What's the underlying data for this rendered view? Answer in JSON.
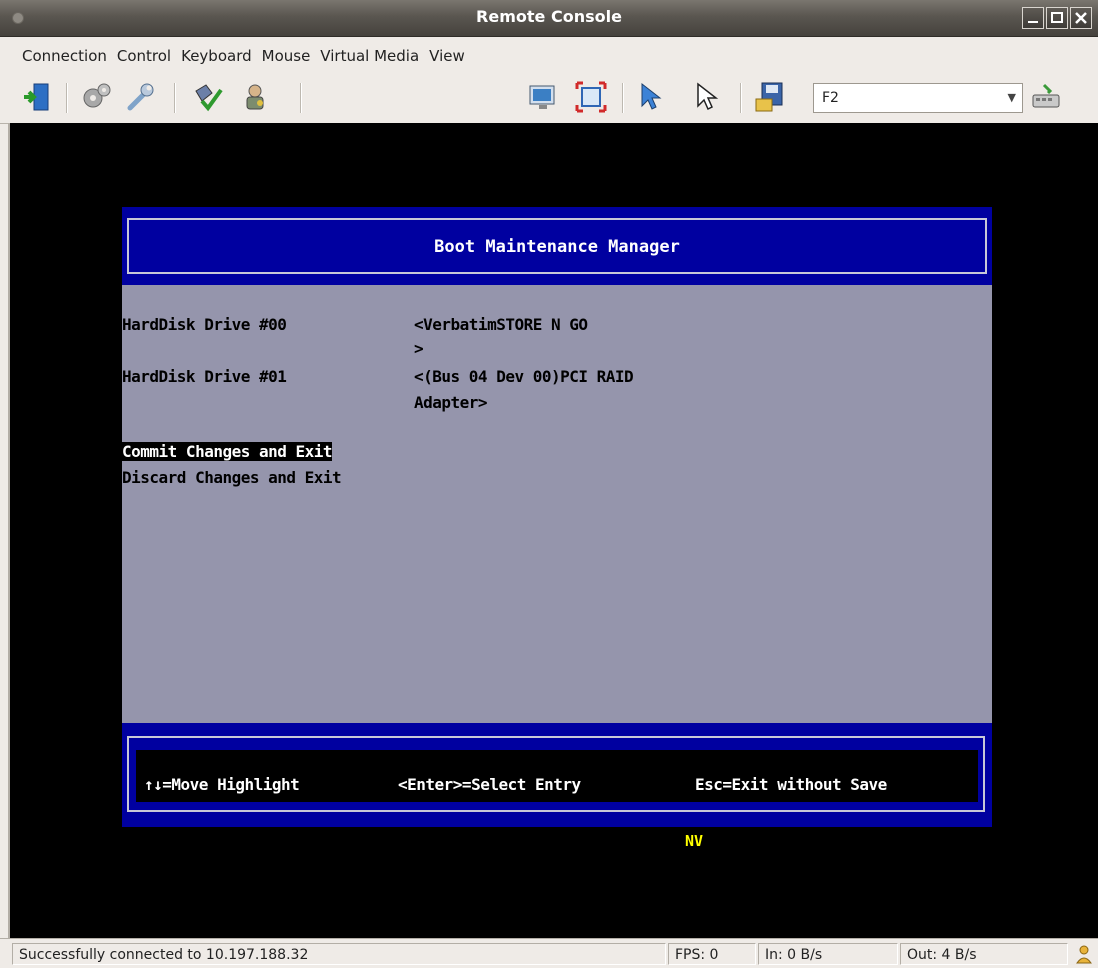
{
  "window": {
    "title": "Remote Console"
  },
  "menu": [
    "Connection",
    "Control",
    "Keyboard",
    "Mouse",
    "Virtual Media",
    "View"
  ],
  "toolbar": {
    "key_combo_value": "F2"
  },
  "bios": {
    "title": "Boot Maintenance Manager",
    "rows": [
      {
        "label": "HardDisk Drive #00",
        "value_line1": "<VerbatimSTORE N GO",
        "value_line2": ">"
      },
      {
        "label": "HardDisk Drive #01",
        "value_line1": "<(Bus 04 Dev 00)PCI RAID",
        "value_line2": "Adapter>"
      }
    ],
    "actions": [
      "Commit Changes and Exit",
      "Discard Changes and Exit"
    ],
    "footer": {
      "move": "↑↓=Move Highlight",
      "select": "<Enter>=Select Entry",
      "exit": "Esc=Exit without Save"
    },
    "indicator": "NV"
  },
  "status": {
    "message": "Successfully connected to 10.197.188.32",
    "fps": "FPS: 0",
    "in": "In: 0 B/s",
    "out": "Out: 4 B/s"
  },
  "colors": {
    "bios_blue": "#0000a0",
    "bios_gray": "#9595ac",
    "nv_yellow": "#ffff00"
  }
}
